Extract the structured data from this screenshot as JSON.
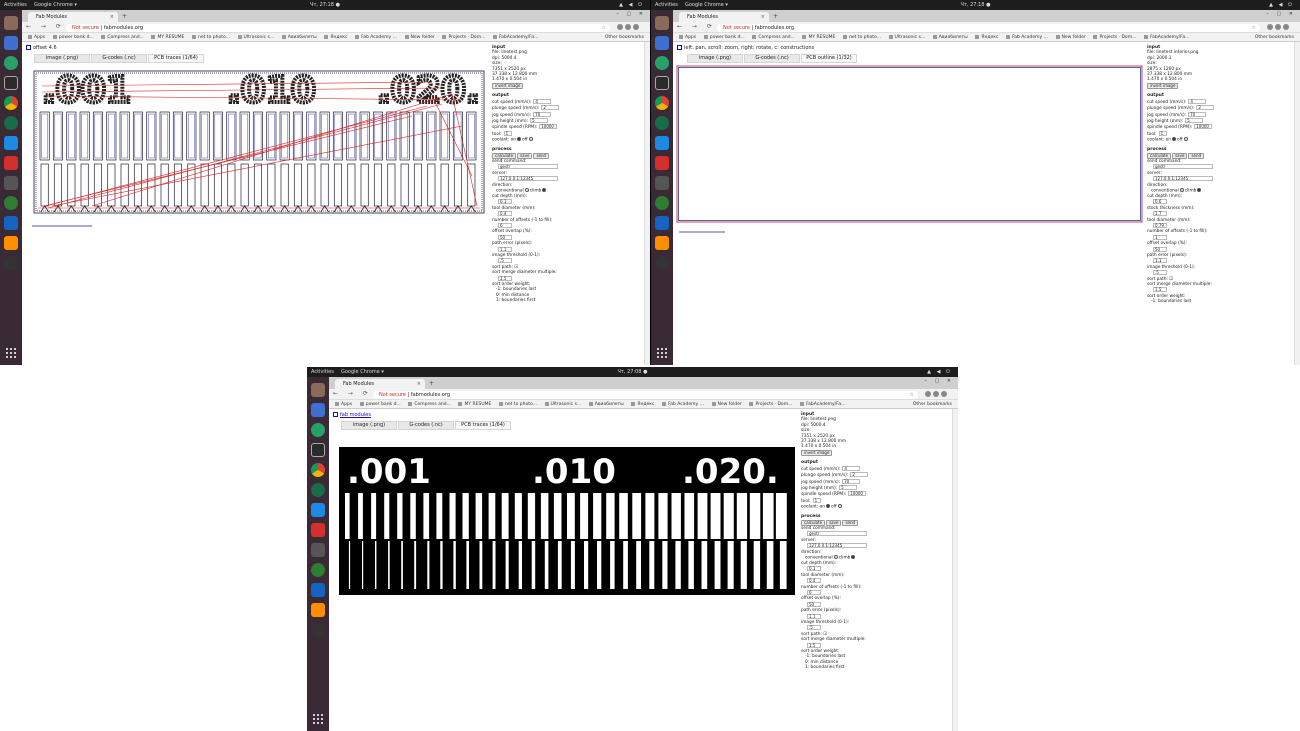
{
  "common": {
    "activities": "Activities",
    "app_menu": "Google Chrome ▾",
    "tab_title": "Fab Modules",
    "not_secure": "Not secure",
    "url": "fabmodules.org",
    "bookmarks": [
      "Apps",
      "power bank d...",
      "Compress and...",
      "MY RESUME",
      "net to photo...",
      "Ultrasonic s...",
      "Авиабилеты",
      "Яндекс",
      "Fab Academy ...",
      "New folder",
      "Projects · Dom...",
      "FabAcademy/Fa..."
    ],
    "other_bookmarks": "Other bookmarks",
    "tabs": [
      "image (.png)",
      "G-codes (.nc)"
    ],
    "input": {
      "heading": "input",
      "file": "file: linetest.png",
      "dpi": "dpi: 5000.4",
      "size": "size:",
      "px": "7351 x 2520 px",
      "mm": "37.338 x 12.800 mm",
      "in": "1.470 x 0.504 in",
      "invert": "invert image"
    },
    "output": {
      "heading": "output",
      "cut_speed": "cut speed (mm/s):",
      "cut_speed_val": "4",
      "plunge_speed": "plunge speed (mm/s):",
      "plunge_speed_val": "2",
      "jog_speed": "jog speed (mm/s):",
      "jog_speed_val": "70",
      "jog_height": "jog height (mm):",
      "jog_height_val": "5",
      "spindle": "spindle speed (RPM):",
      "spindle_val": "10000",
      "tool": "tool:",
      "tool_val": "1",
      "coolant": "coolant: on",
      "coolant_off": "off"
    },
    "process": {
      "heading": "process",
      "calculate": "calculate",
      "save": "save",
      "send": "send",
      "send_command": "send command:",
      "send_command_val": "gestr",
      "server": "server:",
      "server_val": "127.0.0.1:12345",
      "direction": "direction:",
      "conventional": "conventional",
      "climb": "climb",
      "cut_depth": "cut depth (mm):",
      "cut_depth_val": "0.1",
      "tool_diameter": "tool diameter (mm):",
      "tool_diameter_val": "0.4",
      "offsets": "number of offsets (-1 to fill):",
      "offsets_val": "6",
      "overlap": "offset overlap (%):",
      "overlap_val": "50",
      "path_error": "path error (pixels):",
      "path_error_val": "1.1",
      "threshold": "image threshold (0-1):",
      "threshold_val": ".5",
      "sort": "sort path:",
      "sort_merge": "sort merge diameter multiple:",
      "sort_merge_val": "1.5",
      "sort_order": "sort order weight:",
      "w_boundaries_last": "-1: boundaries last",
      "w_min_distance": "0: min distance",
      "w_boundaries_first": "1: boundaries first"
    }
  },
  "screen1": {
    "clock": "Чт, 27:18 ●",
    "info": "offset 4.6",
    "tab3": "PCB traces (1/64)"
  },
  "screen2": {
    "clock": "Чт, 27:18 ●",
    "info": "left: pan, scroll: zoom, right: rotate, c: constructions",
    "tab3": "PCB outline (1/32)",
    "file": "file: linetest interior.png",
    "dpi": "dpi: 2000.1",
    "px": "2875 x 1260 px",
    "mm": "37.338 x 12.800 mm",
    "in": "1.470 x 0.504 in",
    "cut_depth_val": "0.6",
    "stock": "stock thickness (mm):",
    "stock_val": "1.7",
    "tool_diameter_val": "0.79",
    "offsets_val": "1",
    "path_error_val": "1.1",
    "threshold_val": ".5",
    "sort_merge_val": "1.5"
  },
  "screen3": {
    "clock": "Чт, 27:08 ●",
    "info": "fab modules",
    "tab3": "PCB traces (1/64)",
    "labels": [
      ".001",
      ".010",
      ".020."
    ]
  }
}
